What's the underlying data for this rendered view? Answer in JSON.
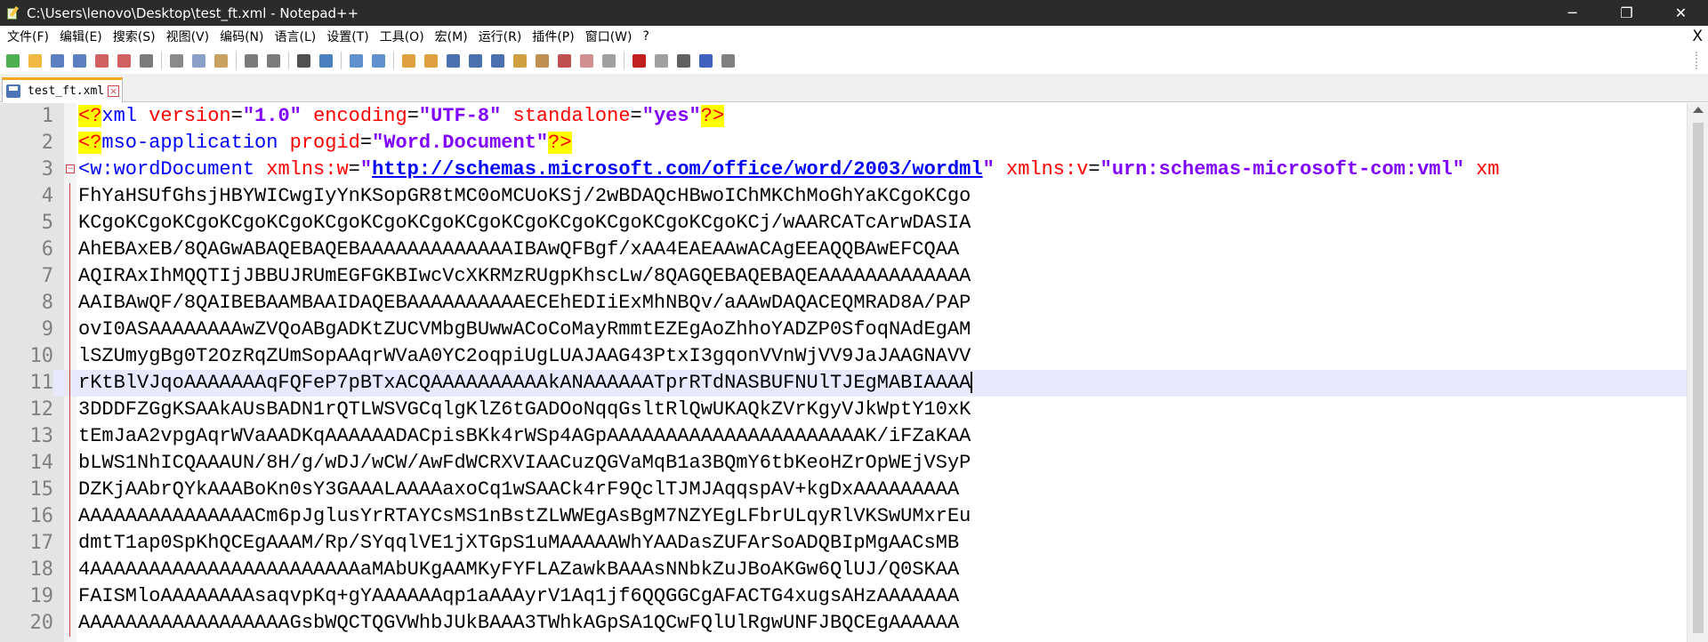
{
  "window": {
    "title": "C:\\Users\\lenovo\\Desktop\\test_ft.xml - Notepad++",
    "controls": {
      "minimize": "─",
      "restore": "❐",
      "close": "✕"
    }
  },
  "menu": {
    "items": [
      "文件(F)",
      "编辑(E)",
      "搜索(S)",
      "视图(V)",
      "编码(N)",
      "语言(L)",
      "设置(T)",
      "工具(O)",
      "宏(M)",
      "运行(R)",
      "插件(P)",
      "窗口(W)",
      "?"
    ],
    "close_doc": "X"
  },
  "toolbar": {
    "buttons": [
      {
        "name": "new-file-icon",
        "color": "#4caf50"
      },
      {
        "name": "open-file-icon",
        "color": "#f0b840"
      },
      {
        "name": "save-icon",
        "color": "#5b7fc0"
      },
      {
        "name": "save-all-icon",
        "color": "#5b7fc0"
      },
      {
        "name": "close-file-icon",
        "color": "#d06060"
      },
      {
        "name": "close-all-icon",
        "color": "#d06060"
      },
      {
        "name": "print-icon",
        "color": "#7a7a7a"
      },
      {
        "sep": true
      },
      {
        "name": "cut-icon",
        "color": "#8a8a8a"
      },
      {
        "name": "copy-icon",
        "color": "#8aa0c8"
      },
      {
        "name": "paste-icon",
        "color": "#c8a060"
      },
      {
        "sep": true
      },
      {
        "name": "undo-icon",
        "color": "#7a7a7a"
      },
      {
        "name": "redo-icon",
        "color": "#7a7a7a"
      },
      {
        "sep": true
      },
      {
        "name": "find-icon",
        "color": "#505050"
      },
      {
        "name": "replace-icon",
        "color": "#4a80c0"
      },
      {
        "sep": true
      },
      {
        "name": "zoom-in-icon",
        "color": "#6090d0"
      },
      {
        "name": "zoom-out-icon",
        "color": "#6090d0"
      },
      {
        "sep": true
      },
      {
        "name": "sync-vertical-icon",
        "color": "#e0a040"
      },
      {
        "name": "sync-horizontal-icon",
        "color": "#e0a040"
      },
      {
        "name": "word-wrap-icon",
        "color": "#4a70b0"
      },
      {
        "name": "show-all-chars-icon",
        "color": "#4a70b0"
      },
      {
        "name": "indent-guide-icon",
        "color": "#4a70b0"
      },
      {
        "name": "lang-define-icon",
        "color": "#d0a040"
      },
      {
        "name": "doc-map-icon",
        "color": "#c09050"
      },
      {
        "name": "function-list-icon",
        "color": "#c05050"
      },
      {
        "name": "folder-workspace-icon",
        "color": "#d09090"
      },
      {
        "name": "monitoring-icon",
        "color": "#a0a0a0"
      },
      {
        "sep": true
      },
      {
        "name": "record-macro-icon",
        "color": "#c02020"
      },
      {
        "name": "stop-macro-icon",
        "color": "#a0a0a0"
      },
      {
        "name": "play-macro-icon",
        "color": "#606060"
      },
      {
        "name": "run-macro-multiple-icon",
        "color": "#4060c0"
      },
      {
        "name": "save-macro-icon",
        "color": "#808080"
      }
    ]
  },
  "tabs": [
    {
      "label": "test_ft.xml"
    }
  ],
  "editor": {
    "current_line": 11,
    "lines": [
      "<?xml version=\"1.0\" encoding=\"UTF-8\" standalone=\"yes\"?>",
      "<?mso-application progid=\"Word.Document\"?>",
      "<w:wordDocument xmlns:w=\"http://schemas.microsoft.com/office/word/2003/wordml\" xmlns:v=\"urn:schemas-microsoft-com:vml\" xm",
      "FhYaHSUfGhsjHBYWICwgIyYnKSopGR8tMC0oMCUoKSj/2wBDAQcHBwoIChMKChMoGhYaKCgoKCgo",
      "KCgoKCgoKCgoKCgoKCgoKCgoKCgoKCgoKCgoKCgoKCgoKCgoKCgoKCgoKCj/wAARCATcArwDASIA",
      "AhEBAxEB/8QAGwABAQEBAQEBAAAAAAAAAAAAAIBAwQFBgf/xAA4EAEAAwACAgEEAQQBAwEFCQAA",
      "AQIRAxIhMQQTIjJBBUJRUmEGFGKBIwcVcXKRMzRUgpKhscLw/8QAGQEBAQEBAQEAAAAAAAAAAAAA",
      "AAIBAwQF/8QAIBEBAAMBAAIDAQEBAAAAAAAAAAECEhEDIiExMhNBQv/aAAwDAQACEQMRAD8A/PAP",
      "ovI0ASAAAAAAAAwZVQoABgADKtZUCVMbgBUwwACoCoMayRmmtEZEgAoZhhoYADZP0SfoqNAdEgAM",
      "lSZUmygBg0T2OzRqZUmSopAAqrWVaA0YC2oqpiUgLUAJAAG43PtxI3gqonVVnWjVV9JaJAAGNAVV",
      "rKtBlVJqoAAAAAAAqFQFeP7pBTxACQAAAAAAAAAAkANAAAAAATprRTdNASBUFNUlTJEgMABIAAAA",
      "3DDDFZGgKSAAkAUsBADN1rQTLWSVGCqlgKlZ6tGADOoNqqGsltRlQwUKAQkZVrKgyVJkWptY10xK",
      "tEmJaA2vpgAqrWVaAADKqAAAAAADACpisBKk4rWSp4AGpAAAAAAAAAAAAAAAAAAAAAAK/iFZaKAA",
      "bLWS1NhICQAAAUN/8H/g/wDJ/wCW/AwFdWCRXVIAACuzQGVaMqB1a3BQmY6tbKeoHZrOpWEjVSyP",
      "DZKjAAbrQYkAAABoKn0sY3GAAALAAAAaxoCq1wSAACk4rF9QclTJMJAqqspAV+kgDxAAAAAAAAA",
      "AAAAAAAAAAAAAAACm6pJglusYrRTAYCsMS1nBstZLWWEgAsBgM7NZYEgLFbrULqyRlVKSwUMxrEu",
      "dmtT1ap0SpKhQCEgAAAM/Rp/SYqqlVE1jXTGpS1uMAAAAAWhYAADasZUFArSoADQBIpMgAACsMB",
      "4AAAAAAAAAAAAAAAAAAAAAAAaMAbUKgAAMKyFYFLAZawkBAAAsNNbkZuJBoAKGw6QlUJ/Q0SKAA",
      "FAISMloAAAAAAAAsaqvpKq+gYAAAAAAqp1aAAAyrV1Aq1jf6QQGGCgAFACTG4xugsAHzAAAAAAA",
      "AAAAAAAAAAAAAAAAAAGsbWQCTQGVWhbJUkBAAA3TWhkAGpSA1QCwFQlUlRgwUNFJBQCEgAAAAAA"
    ]
  }
}
